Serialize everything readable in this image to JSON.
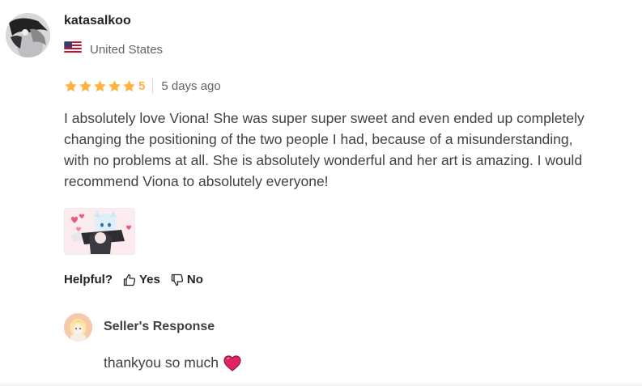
{
  "review": {
    "username": "katasalkoo",
    "country": "United States",
    "rating": "5",
    "rating_value": 5,
    "time_ago": "5 days ago",
    "text": "I absolutely love Viona! She was super super sweet and even ended up completely changing the positioning of the two people I had, because of a misunderstanding, with no problems at all. She is absolutely wonderful and her art is amazing. I would recommend Viona to absolutely everyone!"
  },
  "helpful": {
    "label": "Helpful?",
    "yes_label": "Yes",
    "no_label": "No"
  },
  "seller_response": {
    "title": "Seller's Response",
    "text": "thankyou so much"
  },
  "colors": {
    "star": "#ffb33e",
    "heart": "#e0245e"
  },
  "icons": {
    "flag": "us-flag-icon",
    "star": "star-icon",
    "thumbs_up": "thumbs-up-icon",
    "thumbs_down": "thumbs-down-icon",
    "heart": "heart-icon"
  }
}
